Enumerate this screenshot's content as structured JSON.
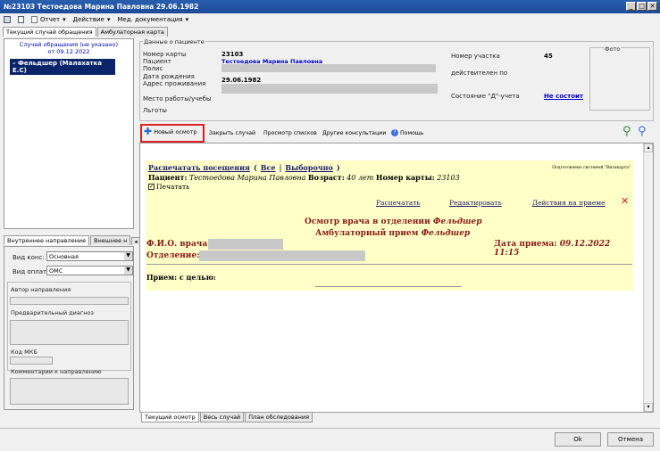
{
  "window": {
    "title": "№23103 Тестоедова Марина Павловна 29.06.1982"
  },
  "menu": {
    "report": "Отчет",
    "action": "Действие",
    "meddoc": "Мед. документация"
  },
  "main_tabs": [
    "Текущий случай обращения",
    "Амбулаторная карта"
  ],
  "left": {
    "case_title": "Случай обращения (не указано)",
    "case_date": "от 09.12.2022",
    "tree_item": "Фельдшер (Малахатка Е.С)",
    "bottom_tabs": [
      "Внутреннее направление",
      "Внешнее н"
    ],
    "vid_kons_label": "Вид конс:",
    "vid_kons_value": "Основная",
    "vid_opl_label": "Вид оплаты",
    "vid_opl_value": "ОМС",
    "author_label": "Автор направления",
    "prelim_label": "Предварительный диагноз",
    "mkb_label": "Код МКБ",
    "comment_label": "Комментарии к направлению"
  },
  "patient": {
    "group_title": "Данные о пациенте",
    "card_label": "Номер карты",
    "card_value": "23103",
    "patient_label": "Пациент",
    "patient_value": "Тестоедова Марина Павловна",
    "polis_label": "Полис",
    "dob_label": "Дата рождения",
    "dob_value": "29.06.1982",
    "address_label": "Адрес проживания",
    "work_label": "Место работы/учебы",
    "benefits_label": "Льготы",
    "uchastok_label": "Номер участка",
    "uchastok_value": "45",
    "valid_label": "действителен по",
    "d_label": "Состояние \"Д\"-учета",
    "d_value": "Не состоит",
    "photo_label": "Фото"
  },
  "toolbar": {
    "new_exam": "Новый осмотр",
    "close_case": "Закрыть случай",
    "view_lists": "Просмотр списков",
    "other_consult": "Другие консультации",
    "help": "Помощь"
  },
  "doc": {
    "print_visits": "Распечатать посещения",
    "all": "Все",
    "selective": "Выборочно",
    "system_note": "Подготовлено системой \"Витакарта\"",
    "patient_label": "Пациент:",
    "patient_name": "Тестоедова Марина Павловна",
    "age_label": "Возраст:",
    "age_value": "40 лет",
    "card_label": "Номер карты:",
    "card_value": "23103",
    "print_checkbox": "Печатать",
    "btn_print": "Распечатать",
    "btn_edit": "Редактировать",
    "btn_actions": "Действия на приеме",
    "exam_title": "Осмотр врача в отделении",
    "exam_title_role": "Фельдшер",
    "reception_title": "Амбулаторный прием",
    "reception_role": "Фельдшер",
    "doctor_label": "Ф.И.О. врача:",
    "date_label": "Дата приема:",
    "date_value": "09.12.2022 11:15",
    "dept_label": "Отделение:",
    "purpose_label": "Прием: с целью:"
  },
  "bottom_tabs": [
    "Текущий осмотр",
    "Весь случай",
    "План обследования"
  ],
  "footer": {
    "ok": "Ok",
    "cancel": "Отмена"
  },
  "colors": {
    "accent_red": "#e02020",
    "doc_bg": "#ffffc8",
    "link_blue": "#0000cc"
  }
}
